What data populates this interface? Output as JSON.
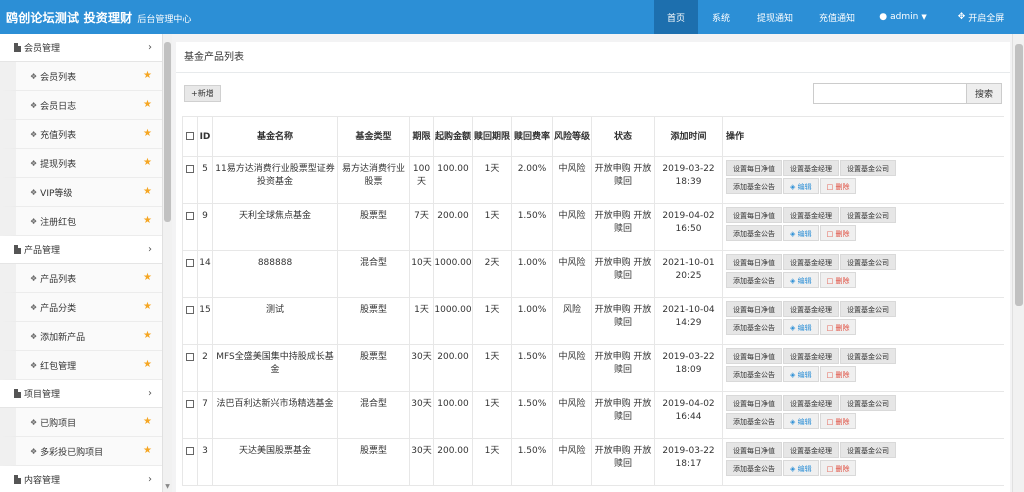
{
  "header": {
    "brand_main": "鸥创论坛测试 投资理财",
    "brand_sub": "后台管理中心",
    "nav": [
      {
        "label": "首页",
        "icon": ""
      },
      {
        "label": "系统",
        "icon": ""
      },
      {
        "label": "提现通知",
        "icon": ""
      },
      {
        "label": "充值通知",
        "icon": ""
      },
      {
        "label": "admin",
        "icon": "user-icon"
      },
      {
        "label": "开启全屏",
        "icon": "fullscreen-icon"
      }
    ],
    "accent": "#2c8fd6"
  },
  "sidebar": {
    "groups": [
      {
        "label": "会员管理",
        "items": [
          "会员列表",
          "会员日志",
          "充值列表",
          "提现列表",
          "VIP等级",
          "注册红包"
        ]
      },
      {
        "label": "产品管理",
        "items": [
          "产品列表",
          "产品分类",
          "添加新产品",
          "红包管理"
        ]
      },
      {
        "label": "项目管理",
        "items": [
          "已购项目",
          "多彩投已购项目"
        ]
      },
      {
        "label": "内容管理",
        "items": []
      }
    ]
  },
  "main": {
    "title": "基金产品列表",
    "add_label": "+新增",
    "search_placeholder": "",
    "search_label": "搜索",
    "columns": [
      "",
      "ID",
      "基金名称",
      "基金类型",
      "期限",
      "起购金额",
      "赎回期限",
      "赎回费率",
      "风险等级",
      "状态",
      "添加时间",
      "操作"
    ],
    "ops": {
      "set_nav": "设置每日净值",
      "set_manager": "设置基金经理",
      "set_company": "设置基金公司",
      "add_notice": "添加基金公告",
      "edit": "编辑",
      "delete": "删除"
    },
    "rows": [
      {
        "id": "5",
        "name": "11易方达消费行业股票型证券投资基金",
        "type": "易方达消费行业股票",
        "term": "100天",
        "min": "100.00",
        "redeem_term": "1天",
        "redeem_rate": "2.00%",
        "risk": "中风险",
        "status": "开放申购 开放赎回",
        "date": "2019-03-22",
        "time": "18:39"
      },
      {
        "id": "9",
        "name": "天利全球焦点基金",
        "type": "股票型",
        "term": "7天",
        "min": "200.00",
        "redeem_term": "1天",
        "redeem_rate": "1.50%",
        "risk": "中风险",
        "status": "开放申购 开放赎回",
        "date": "2019-04-02",
        "time": "16:50"
      },
      {
        "id": "14",
        "name": "888888",
        "type": "混合型",
        "term": "10天",
        "min": "1000.00",
        "redeem_term": "2天",
        "redeem_rate": "1.00%",
        "risk": "中风险",
        "status": "开放申购 开放赎回",
        "date": "2021-10-01",
        "time": "20:25"
      },
      {
        "id": "15",
        "name": "测试",
        "type": "股票型",
        "term": "1天",
        "min": "1000.00",
        "redeem_term": "1天",
        "redeem_rate": "1.00%",
        "risk": "风险",
        "status": "开放申购 开放赎回",
        "date": "2021-10-04",
        "time": "14:29"
      },
      {
        "id": "2",
        "name": "MFS全盛美国集中持股成长基金",
        "type": "股票型",
        "term": "30天",
        "min": "200.00",
        "redeem_term": "1天",
        "redeem_rate": "1.50%",
        "risk": "中风险",
        "status": "开放申购 开放赎回",
        "date": "2019-03-22",
        "time": "18:09"
      },
      {
        "id": "7",
        "name": "法巴百利达新兴市场精选基金",
        "type": "混合型",
        "term": "30天",
        "min": "100.00",
        "redeem_term": "1天",
        "redeem_rate": "1.50%",
        "risk": "中风险",
        "status": "开放申购 开放赎回",
        "date": "2019-04-02",
        "time": "16:44"
      },
      {
        "id": "3",
        "name": "天达美国股票基金",
        "type": "股票型",
        "term": "30天",
        "min": "200.00",
        "redeem_term": "1天",
        "redeem_rate": "1.50%",
        "risk": "中风险",
        "status": "开放申购 开放赎回",
        "date": "2019-03-22",
        "time": "18:17"
      }
    ]
  }
}
